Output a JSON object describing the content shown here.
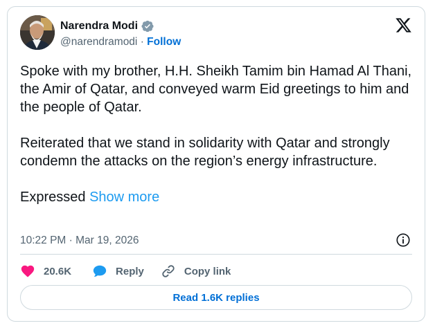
{
  "author": {
    "name": "Narendra Modi",
    "handle": "@narendramodi",
    "separator": " · ",
    "follow_label": "Follow"
  },
  "tweet": {
    "paragraphs": [
      "Spoke with my brother, H.H. Sheikh Tamim bin Hamad Al Thani, the Amir of Qatar, and conveyed warm Eid greetings to him and the people of Qatar.",
      "Reiterated that we stand in solidarity with Qatar and strongly condemn the attacks on the region’s energy infrastructure."
    ],
    "truncated_text": "Expressed",
    "show_more_label": "Show more",
    "timestamp": "10:22 PM · Mar 19, 2026"
  },
  "actions": {
    "likes": "20.6K",
    "reply_label": "Reply",
    "copy_link_label": "Copy link"
  },
  "replies_button_label": "Read 1.6K replies",
  "icons": {
    "verified": "verified-badge-icon",
    "brand": "x-logo-icon",
    "info": "info-icon",
    "like": "heart-icon",
    "reply": "speech-bubble-icon",
    "copy": "link-icon"
  },
  "colors": {
    "link": "#006fd6",
    "show_more": "#1d9bf0",
    "like": "#f91880",
    "reply": "#1d9bf0",
    "secondary_text": "#536471",
    "border": "#cfd9de"
  }
}
